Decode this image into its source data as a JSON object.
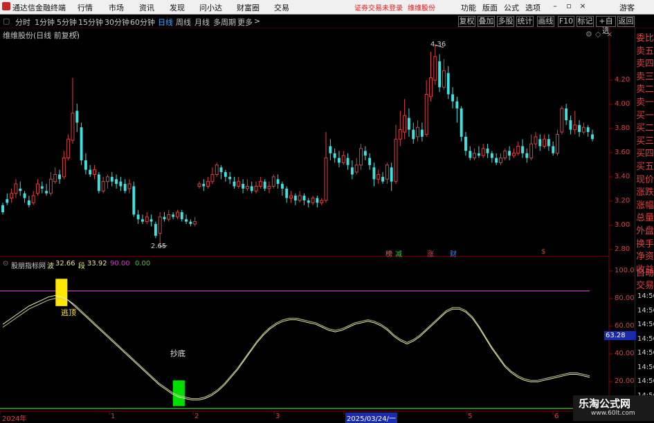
{
  "menubar": {
    "title": "通达信金融终端",
    "items": [
      "行情",
      "市场",
      "资讯",
      "发现",
      "问小达",
      "财富圈",
      "交易"
    ],
    "login": "证券交易未登录",
    "stock": "维维股份",
    "right_items": [
      "功能",
      "版面",
      "公式",
      "选项"
    ],
    "guest": "游客"
  },
  "toolbar": {
    "periods": [
      "分时",
      "1分钟",
      "5分钟",
      "15分钟",
      "30分钟",
      "60分钟",
      "日线",
      "周线",
      "月线",
      "多周期",
      "更多"
    ],
    "active": "日线",
    "more_arrow": ">",
    "right_buttons": [
      "复权",
      "叠加",
      "多股",
      "统计",
      "画线",
      "F10",
      "标记",
      "+自选",
      "返回"
    ]
  },
  "main_chart": {
    "title": "维维股份(日线 前复权)",
    "high_label": "4.36",
    "low_label": "2.65",
    "y_ticks": [
      "4.20",
      "4.00",
      "3.80",
      "3.60",
      "3.40",
      "3.20",
      "3.00",
      "2.80"
    ],
    "event_markers": [
      {
        "text": "榜",
        "color": "#e06060"
      },
      {
        "text": "减",
        "color": "#40c040"
      },
      {
        "text": "涨",
        "color": "#e04040"
      },
      {
        "text": "财",
        "color": "#4080ff"
      },
      {
        "text": "$",
        "color": "#e04040"
      }
    ]
  },
  "chart_data": {
    "type": "candlestick",
    "ylim": [
      2.6,
      4.4
    ],
    "candles": [
      [
        3.0,
        2.94,
        3.02,
        2.92
      ],
      [
        3.05,
        3.02,
        3.1,
        3.0
      ],
      [
        3.06,
        3.1,
        3.14,
        3.02
      ],
      [
        3.1,
        3.18,
        3.22,
        3.06
      ],
      [
        3.14,
        3.12,
        3.2,
        3.08
      ],
      [
        3.1,
        3.06,
        3.12,
        3.02
      ],
      [
        3.04,
        3.0,
        3.08,
        2.98
      ],
      [
        3.02,
        3.08,
        3.12,
        3.0
      ],
      [
        3.1,
        3.18,
        3.22,
        3.08
      ],
      [
        3.16,
        3.14,
        3.2,
        3.1
      ],
      [
        3.12,
        3.1,
        3.18,
        3.08
      ],
      [
        3.1,
        3.22,
        3.28,
        3.08
      ],
      [
        3.2,
        3.26,
        3.32,
        3.18
      ],
      [
        3.26,
        3.22,
        3.3,
        3.18
      ],
      [
        3.24,
        3.4,
        3.46,
        3.22
      ],
      [
        3.4,
        3.56,
        3.6,
        3.38
      ],
      [
        3.55,
        3.78,
        4.08,
        3.52
      ],
      [
        3.8,
        3.7,
        3.86,
        3.62
      ],
      [
        3.66,
        3.38,
        3.7,
        3.34
      ],
      [
        3.38,
        3.3,
        3.44,
        3.26
      ],
      [
        3.3,
        3.26,
        3.34,
        3.24
      ],
      [
        3.26,
        3.3,
        3.34,
        3.22
      ],
      [
        3.26,
        3.12,
        3.28,
        3.1
      ],
      [
        3.12,
        3.2,
        3.24,
        3.1
      ],
      [
        3.2,
        3.24,
        3.26,
        3.14
      ],
      [
        3.24,
        3.2,
        3.28,
        3.16
      ],
      [
        3.22,
        3.18,
        3.26,
        3.14
      ],
      [
        3.2,
        3.16,
        3.24,
        3.12
      ],
      [
        3.18,
        3.12,
        3.22,
        3.1
      ],
      [
        3.14,
        3.18,
        3.22,
        3.1
      ],
      [
        3.16,
        2.92,
        3.2,
        2.9
      ],
      [
        2.92,
        2.88,
        2.96,
        2.84
      ],
      [
        2.88,
        2.86,
        2.92,
        2.84
      ],
      [
        2.86,
        2.9,
        2.94,
        2.84
      ],
      [
        2.88,
        2.86,
        2.92,
        2.82
      ],
      [
        2.84,
        2.74,
        2.86,
        2.72
      ],
      [
        2.76,
        2.9,
        2.94,
        2.65
      ],
      [
        2.9,
        2.88,
        2.94,
        2.86
      ],
      [
        2.88,
        2.92,
        2.96,
        2.86
      ],
      [
        2.92,
        2.9,
        2.94,
        2.88
      ],
      [
        2.9,
        2.94,
        2.96,
        2.88
      ],
      [
        2.94,
        2.88,
        2.96,
        2.86
      ],
      [
        2.88,
        2.86,
        2.92,
        2.84
      ],
      [
        2.86,
        2.84,
        2.88,
        2.82
      ],
      [
        2.84,
        2.86,
        2.9,
        2.82
      ],
      [
        3.16,
        3.18,
        3.2,
        3.14
      ],
      [
        3.18,
        3.16,
        3.22,
        3.12
      ],
      [
        3.16,
        3.2,
        3.24,
        3.14
      ],
      [
        3.2,
        3.26,
        3.32,
        3.18
      ],
      [
        3.26,
        3.34,
        3.36,
        3.24
      ],
      [
        3.32,
        3.28,
        3.34,
        3.22
      ],
      [
        3.28,
        3.24,
        3.3,
        3.2
      ],
      [
        3.24,
        3.22,
        3.28,
        3.18
      ],
      [
        3.2,
        3.16,
        3.24,
        3.14
      ],
      [
        3.16,
        3.2,
        3.24,
        3.14
      ],
      [
        3.18,
        3.14,
        3.22,
        3.1
      ],
      [
        3.14,
        3.16,
        3.22,
        3.12
      ],
      [
        3.16,
        3.12,
        3.2,
        3.1
      ],
      [
        3.12,
        3.16,
        3.2,
        3.1
      ],
      [
        3.16,
        3.2,
        3.24,
        3.14
      ],
      [
        3.2,
        3.14,
        3.22,
        3.12
      ],
      [
        3.14,
        3.16,
        3.2,
        3.1
      ],
      [
        3.16,
        3.24,
        3.26,
        3.14
      ],
      [
        3.22,
        3.18,
        3.26,
        3.14
      ],
      [
        3.18,
        3.14,
        3.2,
        3.08
      ],
      [
        3.14,
        3.06,
        3.16,
        3.02
      ],
      [
        3.06,
        3.08,
        3.12,
        3.02
      ],
      [
        3.08,
        3.04,
        3.1,
        3.0
      ],
      [
        3.04,
        3.08,
        3.12,
        3.02
      ],
      [
        3.08,
        3.04,
        3.1,
        3.0
      ],
      [
        3.04,
        3.02,
        3.06,
        2.98
      ],
      [
        3.02,
        3.06,
        3.08,
        3.0
      ],
      [
        3.06,
        3.02,
        3.08,
        2.98
      ],
      [
        3.02,
        3.04,
        3.06,
        3.0
      ],
      [
        3.04,
        3.4,
        3.62,
        3.02
      ],
      [
        3.5,
        3.44,
        3.56,
        3.38
      ],
      [
        3.44,
        3.4,
        3.48,
        3.36
      ],
      [
        3.4,
        3.36,
        3.46,
        3.32
      ],
      [
        3.36,
        3.42,
        3.46,
        3.34
      ],
      [
        3.4,
        3.34,
        3.44,
        3.3
      ],
      [
        3.32,
        3.26,
        3.38,
        3.22
      ],
      [
        3.28,
        3.34,
        3.4,
        3.26
      ],
      [
        3.34,
        3.48,
        3.52,
        3.3
      ],
      [
        3.46,
        3.42,
        3.5,
        3.38
      ],
      [
        3.4,
        3.34,
        3.44,
        3.3
      ],
      [
        3.32,
        3.22,
        3.36,
        3.16
      ],
      [
        3.22,
        3.26,
        3.3,
        3.18
      ],
      [
        3.24,
        3.2,
        3.28,
        3.18
      ],
      [
        3.22,
        3.34,
        3.36,
        3.18
      ],
      [
        3.32,
        3.2,
        3.36,
        3.12
      ],
      [
        3.2,
        3.56,
        3.68,
        3.18
      ],
      [
        3.56,
        3.64,
        3.8,
        3.5
      ],
      [
        3.62,
        3.76,
        3.9,
        3.56
      ],
      [
        3.74,
        3.64,
        3.82,
        3.58
      ],
      [
        3.64,
        3.56,
        3.7,
        3.52
      ],
      [
        3.58,
        3.66,
        3.72,
        3.54
      ],
      [
        3.64,
        3.58,
        3.7,
        3.54
      ],
      [
        3.6,
        3.94,
        4.06,
        3.58
      ],
      [
        3.92,
        4.08,
        4.3,
        3.88
      ],
      [
        4.06,
        4.26,
        4.36,
        4.02
      ],
      [
        4.22,
        4.0,
        4.28,
        3.96
      ],
      [
        4.0,
        4.14,
        4.24,
        3.98
      ],
      [
        4.12,
        3.94,
        4.18,
        3.9
      ],
      [
        3.94,
        3.88,
        4.0,
        3.82
      ],
      [
        3.88,
        3.82,
        3.92,
        3.7
      ],
      [
        3.82,
        3.58,
        3.84,
        3.54
      ],
      [
        3.58,
        3.46,
        3.62,
        3.42
      ],
      [
        3.46,
        3.4,
        3.5,
        3.38
      ],
      [
        3.4,
        3.44,
        3.48,
        3.38
      ],
      [
        3.44,
        3.42,
        3.5,
        3.4
      ],
      [
        3.42,
        3.48,
        3.52,
        3.4
      ],
      [
        3.48,
        3.44,
        3.52,
        3.4
      ],
      [
        3.44,
        3.4,
        3.46,
        3.36
      ],
      [
        3.4,
        3.36,
        3.44,
        3.34
      ],
      [
        3.36,
        3.4,
        3.44,
        3.34
      ],
      [
        3.4,
        3.46,
        3.48,
        3.38
      ],
      [
        3.46,
        3.42,
        3.5,
        3.38
      ],
      [
        3.42,
        3.44,
        3.48,
        3.4
      ],
      [
        3.44,
        3.5,
        3.54,
        3.42
      ],
      [
        3.5,
        3.44,
        3.56,
        3.4
      ],
      [
        3.44,
        3.4,
        3.48,
        3.36
      ],
      [
        3.4,
        3.52,
        3.6,
        3.38
      ],
      [
        3.52,
        3.58,
        3.62,
        3.48
      ],
      [
        3.56,
        3.5,
        3.6,
        3.46
      ],
      [
        3.5,
        3.56,
        3.6,
        3.48
      ],
      [
        3.56,
        3.5,
        3.6,
        3.46
      ],
      [
        3.5,
        3.44,
        3.54,
        3.42
      ],
      [
        3.44,
        3.6,
        3.64,
        3.42
      ],
      [
        3.62,
        3.82,
        3.84,
        3.6
      ],
      [
        3.82,
        3.72,
        3.86,
        3.68
      ],
      [
        3.72,
        3.64,
        3.76,
        3.6
      ],
      [
        3.64,
        3.68,
        3.8,
        3.6
      ],
      [
        3.68,
        3.62,
        3.72,
        3.58
      ],
      [
        3.62,
        3.66,
        3.7,
        3.6
      ],
      [
        3.66,
        3.62,
        3.68,
        3.58
      ],
      [
        3.6,
        3.56,
        3.64,
        3.54
      ]
    ],
    "indicator": {
      "name": "股朋指标网",
      "series": [
        {
          "name": "波",
          "value": "32.66",
          "color": "#e8e8a0"
        },
        {
          "name": "段",
          "value": "33.92",
          "color": "#e8e8a0"
        },
        {
          "name": "",
          "value": "90.00",
          "color": "#c040c0"
        },
        {
          "name": "",
          "value": "0.00",
          "color": "#40c040"
        }
      ],
      "ylim": [
        12,
        105
      ],
      "ref_line_high": 90,
      "ref_line_low": 0,
      "wave": [
        68,
        71,
        74,
        77,
        80,
        82,
        84,
        86,
        87,
        86,
        84,
        80,
        76,
        72,
        68,
        64,
        60,
        56,
        52,
        48,
        44,
        40,
        36,
        32,
        28,
        25,
        22,
        20,
        19,
        18,
        18,
        19,
        21,
        24,
        28,
        33,
        38,
        44,
        50,
        56,
        61,
        65,
        68,
        70,
        71,
        71,
        70,
        69,
        68,
        66,
        64,
        63,
        64,
        66,
        68,
        69,
        70,
        69,
        67,
        64,
        60,
        57,
        55,
        57,
        60,
        64,
        68,
        72,
        76,
        78,
        78,
        76,
        72,
        66,
        59,
        52,
        46,
        40,
        36,
        33,
        31,
        30,
        30,
        31,
        32,
        33,
        34,
        35,
        35,
        34,
        33
      ],
      "segment": [
        66,
        69,
        72,
        75,
        78,
        80,
        82,
        84,
        85,
        85,
        84,
        81,
        77,
        73,
        69,
        65,
        61,
        57,
        53,
        49,
        45,
        41,
        37,
        33,
        29,
        26,
        23,
        21,
        20,
        19,
        19,
        20,
        22,
        25,
        29,
        34,
        39,
        45,
        51,
        57,
        62,
        66,
        69,
        71,
        72,
        72,
        71,
        70,
        69,
        67,
        65,
        64,
        65,
        67,
        69,
        70,
        71,
        70,
        68,
        65,
        61,
        58,
        56,
        58,
        61,
        65,
        69,
        73,
        77,
        79,
        79,
        77,
        73,
        67,
        60,
        53,
        47,
        41,
        37,
        34,
        32,
        31,
        31,
        32,
        33,
        34,
        35,
        36,
        36,
        35,
        34
      ],
      "signals": [
        {
          "label": "逃顶",
          "color": "#ffe800",
          "index": 9,
          "from": 80,
          "to": 98
        },
        {
          "label": "抄底",
          "color": "#00dd00",
          "index": 27,
          "from": 14,
          "to": 31
        }
      ],
      "y_ticks": [
        "100.0",
        "80.00",
        "60.00",
        "40.00",
        "20.00"
      ],
      "current_value": "63.28"
    }
  },
  "x_axis": {
    "labels": [
      "2024年",
      "1",
      "2",
      "3",
      "2025/03/24/一",
      "5",
      "6"
    ],
    "highlight": "2025/03/24/一"
  },
  "side_panel": {
    "items": [
      "委比",
      "卖五",
      "卖四",
      "卖三",
      "卖二",
      "卖一",
      "买一",
      "买二",
      "买三",
      "买四",
      "买五",
      "现价",
      "涨跌",
      "涨幅",
      "总量",
      "外盘",
      "换手",
      "净资",
      "收益",
      "自动",
      "交易"
    ],
    "times": [
      "14:56",
      "14:56",
      "14:56",
      "14:56",
      "14:56",
      "14:56",
      "14:56",
      "14:56",
      "14:56"
    ]
  },
  "watermark": {
    "line1": "乐淘公式网",
    "line2": "www.60lt.com"
  },
  "colors": {
    "up": "#e04040",
    "down": "#40e0e0",
    "bg": "#000000",
    "axis": "#8b0000"
  }
}
